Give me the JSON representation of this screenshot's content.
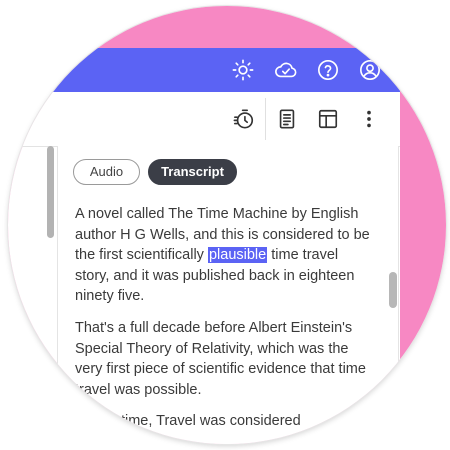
{
  "header": {
    "icons": [
      "sun-icon",
      "cloud-check-icon",
      "help-icon",
      "account-icon"
    ]
  },
  "toolbar": {
    "icons": [
      "timer-icon",
      "document-icon",
      "layout-icon",
      "more-vert-icon"
    ]
  },
  "tabs": {
    "audio_label": "Audio",
    "transcript_label": "Transcript",
    "active": "Transcript"
  },
  "transcript": {
    "p1_before": "A novel called The Time Machine by English author H G Wells, and this is considered to be the first scientifically ",
    "p1_highlight": "plausible",
    "p1_after": " time travel story, and it was published back in eighteen ninety five.",
    "p2": "That's a full decade before Albert Einstein's Special Theory of Relativity, which was the very first piece of scientific evidence that time travel was possible.",
    "p3": "At that time, Travel was considered"
  },
  "colors": {
    "accent": "#5b63f4",
    "background": "#f788c3",
    "tab_active": "#3b3e47"
  }
}
